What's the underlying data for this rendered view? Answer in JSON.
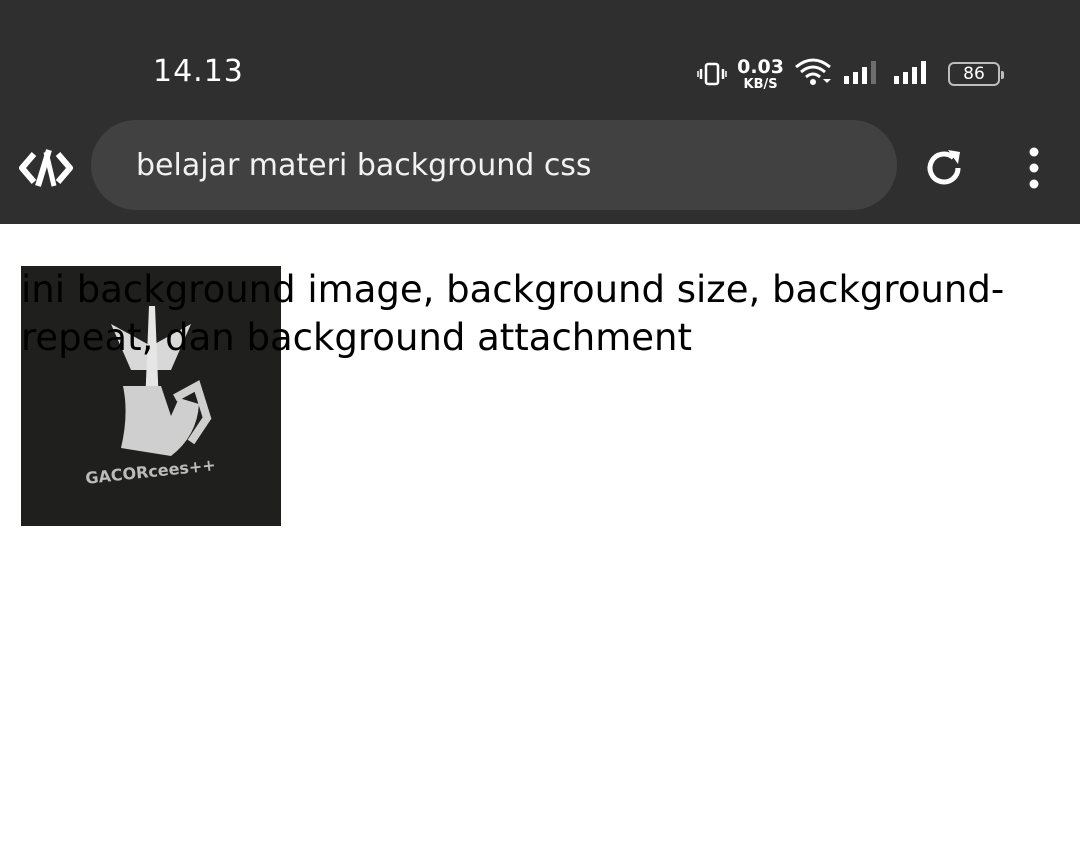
{
  "status_bar": {
    "time": "14.13",
    "net_speed_value": "0.03",
    "net_speed_unit": "KB/S",
    "battery_level": "86",
    "icons": [
      "vibrate-icon",
      "wifi-icon",
      "signal-icon",
      "signal-icon",
      "battery-icon"
    ]
  },
  "toolbar": {
    "url_text": "belajar materi background css",
    "icons": [
      "code-icon",
      "reload-icon",
      "more-vert-icon"
    ]
  },
  "page": {
    "text": "ini background image, background size, background-repeat, dan background attachment",
    "background_image_logo_text": "GACORcees++"
  },
  "colors": {
    "status_bar_bg": "#2f2f2f",
    "url_bar_bg": "#414141",
    "page_bg": "#ffffff",
    "image_bg": "#1f201d"
  }
}
